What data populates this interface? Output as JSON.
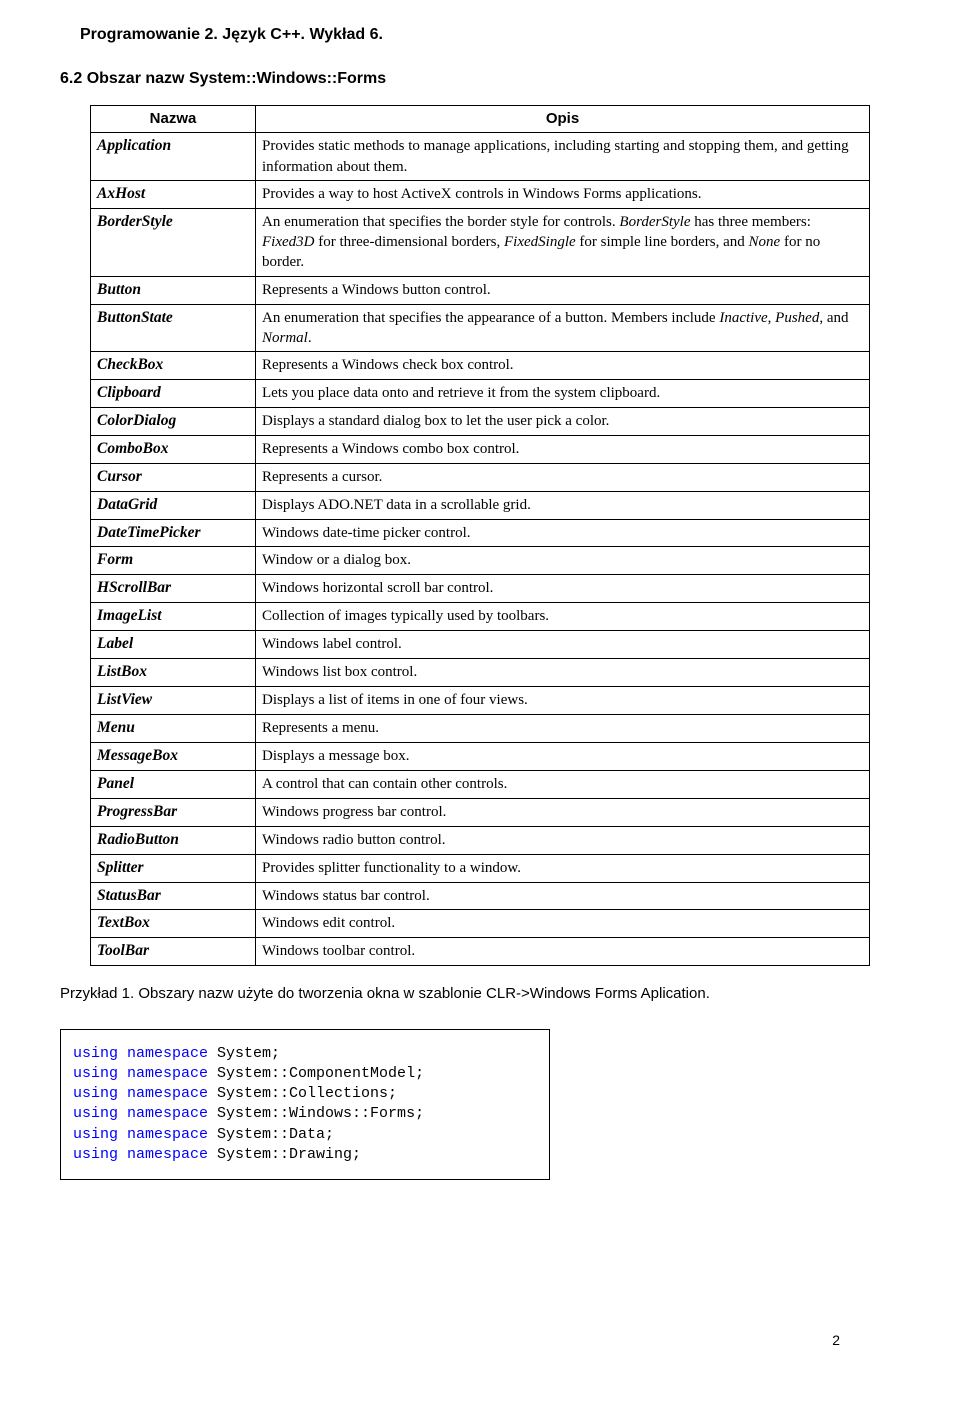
{
  "header": "Programowanie 2. Język C++. Wykład 6.",
  "section_heading": "6.2 Obszar nazw System::Windows::Forms",
  "table": {
    "col1_header": "Nazwa",
    "col2_header": "Opis",
    "rows": [
      {
        "name": "Application",
        "desc_pre": "Provides static methods to manage applications, including starting and stopping them, and getting information about them."
      },
      {
        "name": "AxHost",
        "desc_pre": "Provides a way to host ActiveX controls in Windows Forms applications."
      },
      {
        "name": "BorderStyle",
        "desc_pre": "An enumeration that specifies the border style for controls. ",
        "it1": "BorderStyle",
        "mid1": " has three members: ",
        "it2": "Fixed3D",
        "mid2": " for three-dimensional borders, ",
        "it3": "FixedSingle",
        "mid3": " for simple line borders, and ",
        "it4": "None",
        "desc_post": " for no border."
      },
      {
        "name": "Button",
        "desc_pre": "Represents a Windows button control."
      },
      {
        "name": "ButtonState",
        "desc_pre": "An enumeration that specifies the appearance of a button. Members include ",
        "it1": "Inactive",
        "mid1": ", ",
        "it2": "Pushed",
        "mid2": ", and ",
        "it3": "Normal",
        "desc_post": "."
      },
      {
        "name": "CheckBox",
        "desc_pre": "Represents a Windows check box control."
      },
      {
        "name": "Clipboard",
        "desc_pre": "Lets you place data onto and retrieve it from the system clipboard."
      },
      {
        "name": "ColorDialog",
        "desc_pre": "Displays a standard dialog box to let the user pick a color."
      },
      {
        "name": "ComboBox",
        "desc_pre": "Represents a Windows combo box control."
      },
      {
        "name": "Cursor",
        "desc_pre": "Represents a cursor."
      },
      {
        "name": "DataGrid",
        "desc_pre": "Displays ADO.NET data in a scrollable grid."
      },
      {
        "name": "DateTimePicker",
        "desc_pre": " Windows date-time picker control."
      },
      {
        "name": "Form",
        "desc_pre": "Window or a dialog box."
      },
      {
        "name": "HScrollBar",
        "desc_pre": " Windows horizontal scroll bar control."
      },
      {
        "name": "ImageList",
        "desc_pre": "Collection of images typically used by toolbars."
      },
      {
        "name": "Label",
        "desc_pre": "Windows label control."
      },
      {
        "name": "ListBox",
        "desc_pre": " Windows list box control."
      },
      {
        "name": "ListView",
        "desc_pre": "Displays a list of items in one of four views."
      },
      {
        "name": "Menu",
        "desc_pre": "Represents a menu."
      },
      {
        "name": "MessageBox",
        "desc_pre": "Displays a message box."
      },
      {
        "name": "Panel",
        "desc_pre": "A control that can contain other controls."
      },
      {
        "name": "ProgressBar",
        "desc_pre": " Windows progress bar control."
      },
      {
        "name": "RadioButton",
        "desc_pre": "Windows radio button control."
      },
      {
        "name": "Splitter",
        "desc_pre": "Provides splitter functionality to a window."
      },
      {
        "name": "StatusBar",
        "desc_pre": "Windows status bar control."
      },
      {
        "name": "TextBox",
        "desc_pre": "Windows edit control."
      },
      {
        "name": "ToolBar",
        "desc_pre": "Windows toolbar control."
      }
    ]
  },
  "example_label": "Przykład 1. Obszary nazw użyte do tworzenia okna w szablonie CLR->Windows Forms Aplication.",
  "code": {
    "kw": "using namespace",
    "lines": [
      "System;",
      "System::ComponentModel;",
      "System::Collections;",
      "System::Windows::Forms;",
      "System::Data;",
      "System::Drawing;"
    ]
  },
  "page_number": "2"
}
